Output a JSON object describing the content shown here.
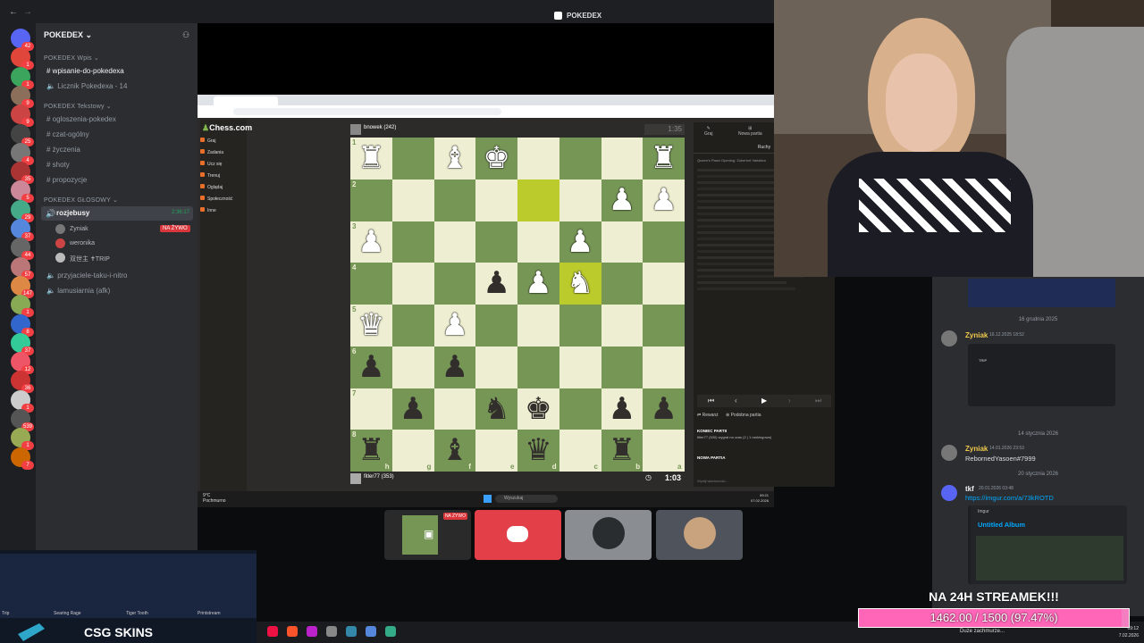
{
  "discord": {
    "window_title": "POKEDEX",
    "server_name": "POKEDEX",
    "categories": {
      "wpis": "POKEDEX Wpis",
      "text": "POKEDEX Tekstowy",
      "voice": "POKEDEX GŁOSOWY"
    },
    "channels_wpis": [
      "wpisanie-do-pokedexa",
      "Licznik Pokedexa - 14"
    ],
    "channels_text": [
      "ogloszenia-pokedex",
      "czat-ogólny",
      "życzenia",
      "shoty",
      "propozycje"
    ],
    "voice_channel": {
      "name": "rozjebusy",
      "timer": "2:36:17"
    },
    "voice_users": [
      {
        "name": "Zyniak",
        "badge": "NA ŻYWO"
      },
      {
        "name": "weronika",
        "badge": ""
      },
      {
        "name": "双世主 ✝TRIP",
        "badge": ""
      }
    ],
    "voice_other": [
      "przyjaciele-taku-i-nitro",
      "lamusiarnia (afk)"
    ],
    "server_badges": [
      "42",
      "1",
      "1",
      "9",
      "9",
      "25",
      "4",
      "35",
      "5",
      "29",
      "37",
      "44",
      "57",
      "147",
      "1",
      "8",
      "37",
      "12",
      "36",
      "1",
      "539",
      "1",
      "7"
    ]
  },
  "chess": {
    "brand": "Chess.com",
    "nav": [
      "Graj",
      "Zadania",
      "Ucz się",
      "Trenuj",
      "Oglądaj",
      "Społeczność",
      "Inne"
    ],
    "top_player": "bnowek (242)",
    "bottom_player": "fitler77 (353)",
    "top_clock": "1:35",
    "bottom_clock": "1:03",
    "files": [
      "h",
      "g",
      "f",
      "e",
      "d",
      "c",
      "b",
      "a"
    ],
    "ranks": [
      "1",
      "2",
      "3",
      "4",
      "5",
      "6",
      "7",
      "8"
    ],
    "panel_tabs": [
      "Graj",
      "Nowa partia"
    ],
    "panel_header": "Ruchy",
    "opening": "Queen's Pawn Opening: Zukertort Variation",
    "game_over_title": "KONIEC PARTII",
    "game_over_text": "fitler77 (530) wygrał na czas (2 | 1 rankingowa)",
    "new_game": "NOWA PARTIA",
    "chat_placeholder": "Wyślij wiadomość...",
    "revanche": "Rewanż",
    "new_game_btn": "Podobna partia"
  },
  "screen_taskbar": {
    "weather": "9°C",
    "weather_label": "Pochmurno",
    "search": "Wyszukaj",
    "time": "09:21",
    "date": "07.02.2026"
  },
  "tiles": [
    {
      "label": "NA ŻYWO"
    }
  ],
  "chat": {
    "divider1": "16 grudnia 2025",
    "msg1_user": "Zyniak",
    "msg1_time": "16.12.2025 18:52",
    "msg1_text": "TRIP",
    "divider2": "14 stycznia 2026",
    "msg2_user": "Zyniak",
    "msg2_time": "14.01.2026 23:53",
    "msg2_text": "RebornedYasoen#7999",
    "divider3": "20 stycznia 2026",
    "msg3_user": "tkf",
    "msg3_time": "20.01.2026 03:48",
    "msg3_link": "https://imgur.com/a/73kROTD",
    "embed_site": "Imgur",
    "embed_title": "Untitled Album"
  },
  "overlay": {
    "goal_title": "NA 24H STREAMEK!!!",
    "goal_text": "1462.00 / 1500 (97.47%)",
    "goal_current": 1462,
    "goal_target": 1500,
    "goal_percent": 97.47,
    "ad_brand": "CSG SKINS",
    "ad_items": [
      "Trip",
      "Searing Rage",
      "Tiger Tooth",
      "Printstream"
    ]
  },
  "taskbar": {
    "time": "09:12",
    "date": "7.02.2026",
    "notice": "Duże zachmurze..."
  },
  "colors": {
    "board_light": "#eeeed2",
    "board_dark": "#769656",
    "highlight": "#bbcb2b",
    "discord_accent": "#5865f2",
    "goal_pink": "#f47fc0"
  }
}
